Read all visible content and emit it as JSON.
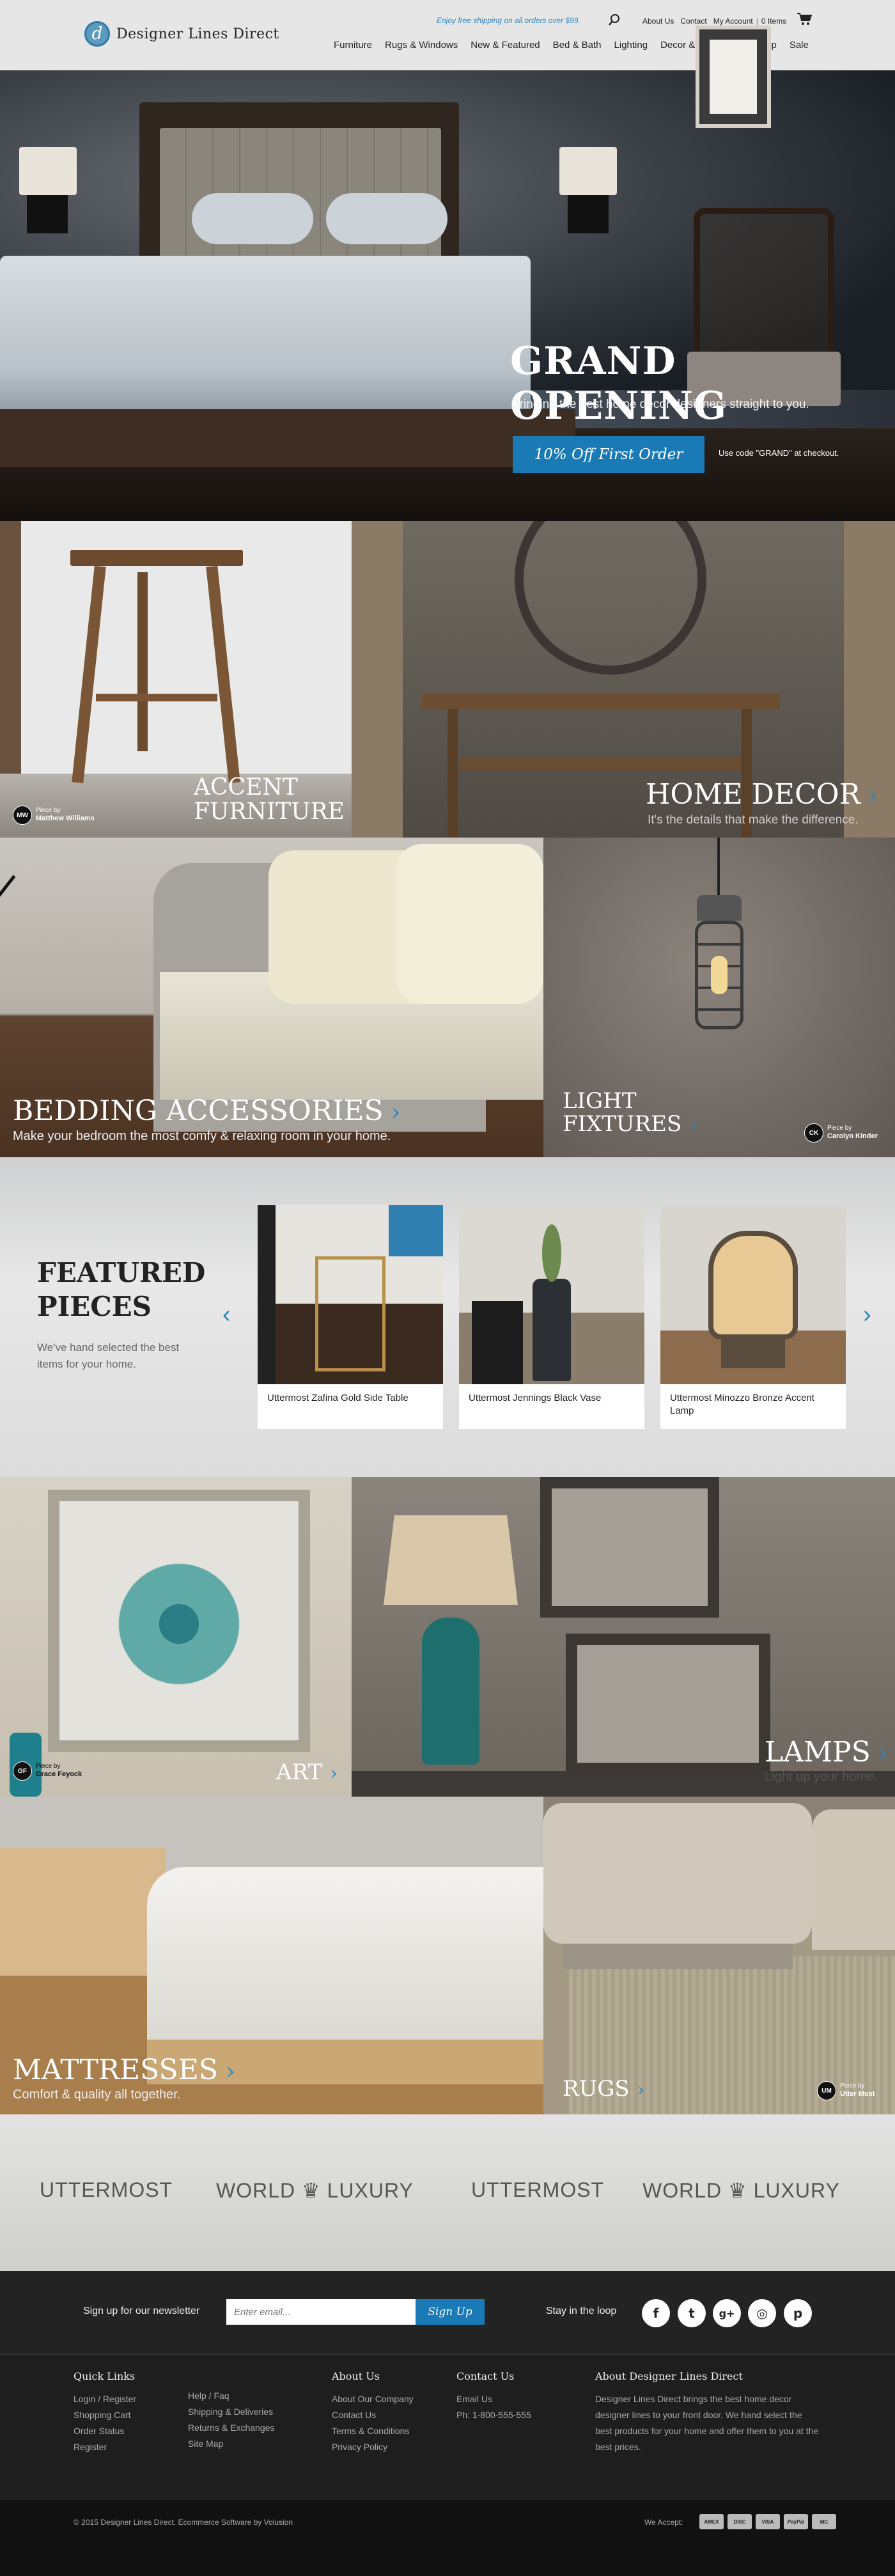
{
  "header": {
    "logo_text": "Designer Lines Direct",
    "logo_mark": "d",
    "promo": "Enjoy free shipping on all orders over $99.",
    "util_links": [
      "About Us",
      "Contact",
      "My Account",
      "0 Items"
    ],
    "nav": [
      "Furniture",
      "Rugs & Windows",
      "New & Featured",
      "Bed & Bath",
      "Lighting",
      "Decor & Pillows",
      "Tabletop",
      "Sale"
    ]
  },
  "hero": {
    "title": "GRAND OPENING",
    "subtitle": "Bringing the best home decor designers straight to you.",
    "button": "10% Off First Order",
    "code_note": "Use code \"GRAND\" at checkout."
  },
  "tiles": {
    "accent": {
      "line1": "ACCENT",
      "line2": "FURNITURE",
      "piece_initials": "MW",
      "piece_by": "Piece by",
      "piece_name": "Matthew Williams"
    },
    "homedecor": {
      "title": "HOME DECOR",
      "subtitle": "It's the details that make the difference."
    },
    "bedding": {
      "title": "BEDDING ACCESSORIES",
      "subtitle": "Make your bedroom the most comfy & relaxing room in your home."
    },
    "light": {
      "line1": "LIGHT",
      "line2": "FIXTURES",
      "piece_initials": "CK",
      "piece_by": "Piece by",
      "piece_name": "Carolyn Kinder"
    },
    "art": {
      "title": "ART",
      "piece_initials": "GF",
      "piece_by": "Piece by",
      "piece_name": "Grace Feyock"
    },
    "lamps": {
      "title": "LAMPS",
      "subtitle": "Light up your home."
    },
    "mattresses": {
      "title": "MATTRESSES",
      "subtitle": "Comfort & quality all together."
    },
    "rugs": {
      "title": "RUGS",
      "piece_initials": "UM",
      "piece_by": "Piece by",
      "piece_name": "Utter Most"
    }
  },
  "featured": {
    "line1": "FEATURED",
    "line2": "PIECES",
    "subtitle": "We've hand selected the best items for your home.",
    "items": [
      {
        "name": "Uttermost Zafina Gold Side Table"
      },
      {
        "name": "Uttermost Jennings Black Vase"
      },
      {
        "name": "Uttermost Minozzo Bronze Accent Lamp"
      }
    ]
  },
  "brands": [
    "UTTERMOST",
    "WORLD ♛ LUXURY",
    "UTTERMOST",
    "WORLD ♛ LUXURY"
  ],
  "newsletter": {
    "label": "Sign up for our newsletter",
    "placeholder": "Enter email...",
    "button": "Sign Up",
    "loop_label": "Stay in the loop",
    "social": [
      "f",
      "t",
      "g+",
      "◎",
      "p"
    ]
  },
  "footer": {
    "quick_links": {
      "heading": "Quick Links",
      "col1": [
        "Login / Register",
        "Shopping Cart",
        "Order Status",
        "Register"
      ],
      "col2": [
        "Help / Faq",
        "Shipping & Deliveries",
        "Returns & Exchanges",
        "Site Map"
      ]
    },
    "about": {
      "heading": "About Us",
      "links": [
        "About Our Company",
        "Contact Us",
        "Terms & Conditions",
        "Privacy Policy"
      ]
    },
    "contact": {
      "heading": "Contact Us",
      "email": "Email Us",
      "phone": "Ph: 1-800-555-555"
    },
    "about_dld": {
      "heading": "About Designer Lines Direct",
      "text": "Designer Lines Direct brings the  best home decor designer lines to your front door. We hand select the best products for your home and offer them to you at the best prices."
    }
  },
  "bottom": {
    "copyright": "© 2015 Designer Lines Direct. Ecommerce Software by Volusion",
    "accept": "We Accept:",
    "payments": [
      "AMEX",
      "DISC",
      "VISA",
      "PayPal",
      "MC"
    ]
  },
  "colors": {
    "accent": "#1a7ab5",
    "chevron": "#2e86c1",
    "header_bg": "#e6e6e6",
    "footer_bg": "#1e1e1e"
  }
}
